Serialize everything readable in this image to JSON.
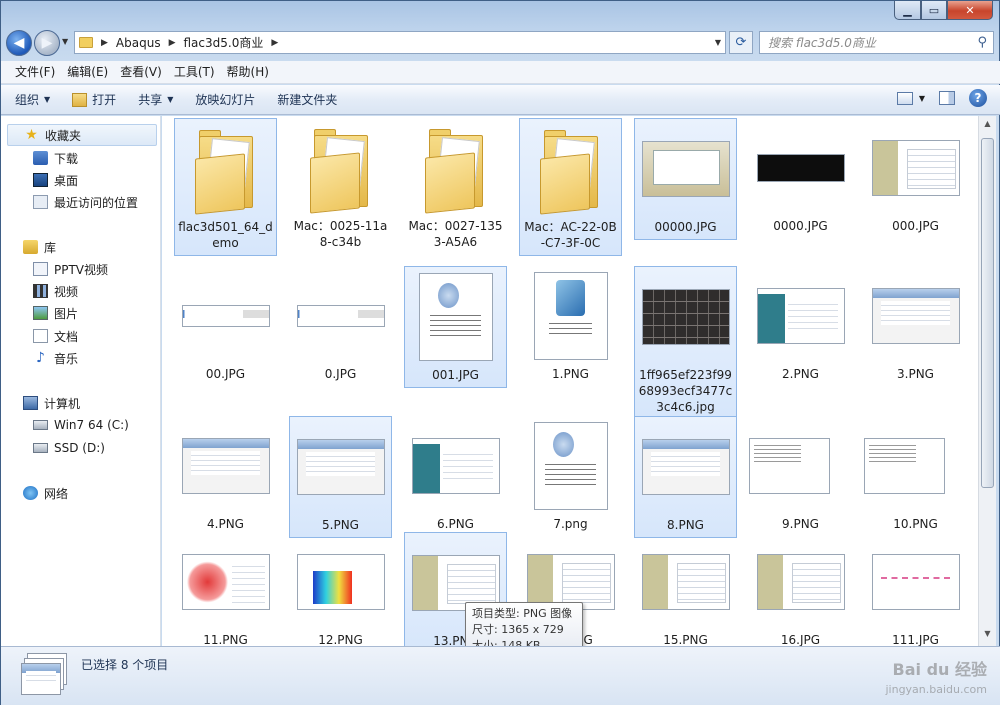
{
  "window": {
    "address": {
      "crumbs": [
        "Abaqus",
        "flac3d5.0商业"
      ]
    },
    "search": {
      "placeholder": "搜索 flac3d5.0商业"
    }
  },
  "menubar": [
    "文件(F)",
    "编辑(E)",
    "查看(V)",
    "工具(T)",
    "帮助(H)"
  ],
  "toolbar": {
    "organize": "组织",
    "open": "打开",
    "share": "共享",
    "slideshow": "放映幻灯片",
    "new_folder": "新建文件夹"
  },
  "sidebar": {
    "favorites": {
      "label": "收藏夹",
      "items": [
        "下载",
        "桌面",
        "最近访问的位置"
      ]
    },
    "libraries": {
      "label": "库",
      "items": [
        "PPTV视频",
        "视频",
        "图片",
        "文档",
        "音乐"
      ]
    },
    "computer": {
      "label": "计算机",
      "items": [
        "Win7 64 (C:)",
        "SSD (D:)"
      ]
    },
    "network": {
      "label": "网络"
    }
  },
  "files": [
    {
      "name": "flac3d501_64_demo",
      "kind": "folder",
      "selected": true
    },
    {
      "name": "Mac：0025-11a8-c34b",
      "kind": "folder",
      "selected": false
    },
    {
      "name": "Mac：0027-1353-A5A6",
      "kind": "folder",
      "selected": false
    },
    {
      "name": "Mac：AC-22-0B-C7-3F-0C",
      "kind": "folder",
      "selected": true
    },
    {
      "name": "00000.JPG",
      "kind": "browser",
      "selected": true
    },
    {
      "name": "0000.JPG",
      "kind": "dark",
      "selected": false
    },
    {
      "name": "000.JPG",
      "kind": "side",
      "selected": false
    },
    {
      "name": "00.JPG",
      "kind": "strip",
      "selected": false
    },
    {
      "name": "0.JPG",
      "kind": "strip",
      "selected": false
    },
    {
      "name": "001.JPG",
      "kind": "doc",
      "selected": true,
      "thumb_text": "FLAC3D 5.0 64-bit.msi"
    },
    {
      "name": "1.PNG",
      "kind": "msi",
      "selected": false,
      "thumb_text": "FLAC3D 5.0 64-bit.msi"
    },
    {
      "name": "1ff965ef223f9968993ecf3477c3c4c6.jpg",
      "kind": "keyboard",
      "selected": true
    },
    {
      "name": "2.PNG",
      "kind": "teal",
      "selected": false
    },
    {
      "name": "3.PNG",
      "kind": "dialog",
      "selected": false
    },
    {
      "name": "4.PNG",
      "kind": "dialog",
      "selected": false
    },
    {
      "name": "5.PNG",
      "kind": "dialog",
      "selected": true
    },
    {
      "name": "6.PNG",
      "kind": "teal",
      "selected": false
    },
    {
      "name": "7.png",
      "kind": "doc",
      "selected": false
    },
    {
      "name": "8.PNG",
      "kind": "dialog",
      "selected": true
    },
    {
      "name": "9.PNG",
      "kind": "cmd",
      "selected": false
    },
    {
      "name": "10.PNG",
      "kind": "cmd",
      "selected": false
    },
    {
      "name": "11.PNG",
      "kind": "red",
      "selected": false
    },
    {
      "name": "12.PNG",
      "kind": "contour",
      "selected": false
    },
    {
      "name": "13.PNG",
      "kind": "side",
      "selected": true
    },
    {
      "name": "14.PNG",
      "kind": "side",
      "selected": false
    },
    {
      "name": "15.PNG",
      "kind": "side",
      "selected": false
    },
    {
      "name": "16.JPG",
      "kind": "side",
      "selected": false
    },
    {
      "name": "111.JPG",
      "kind": "pink",
      "selected": false
    }
  ],
  "tooltip": {
    "type": "项目类型: PNG 图像",
    "size": "尺寸: 1365 x 729",
    "filesize": "大小: 148 KB"
  },
  "status": {
    "selected": "已选择 8 个项目"
  },
  "watermark": {
    "brand": "Bai du 经验",
    "url": "jingyan.baidu.com"
  }
}
